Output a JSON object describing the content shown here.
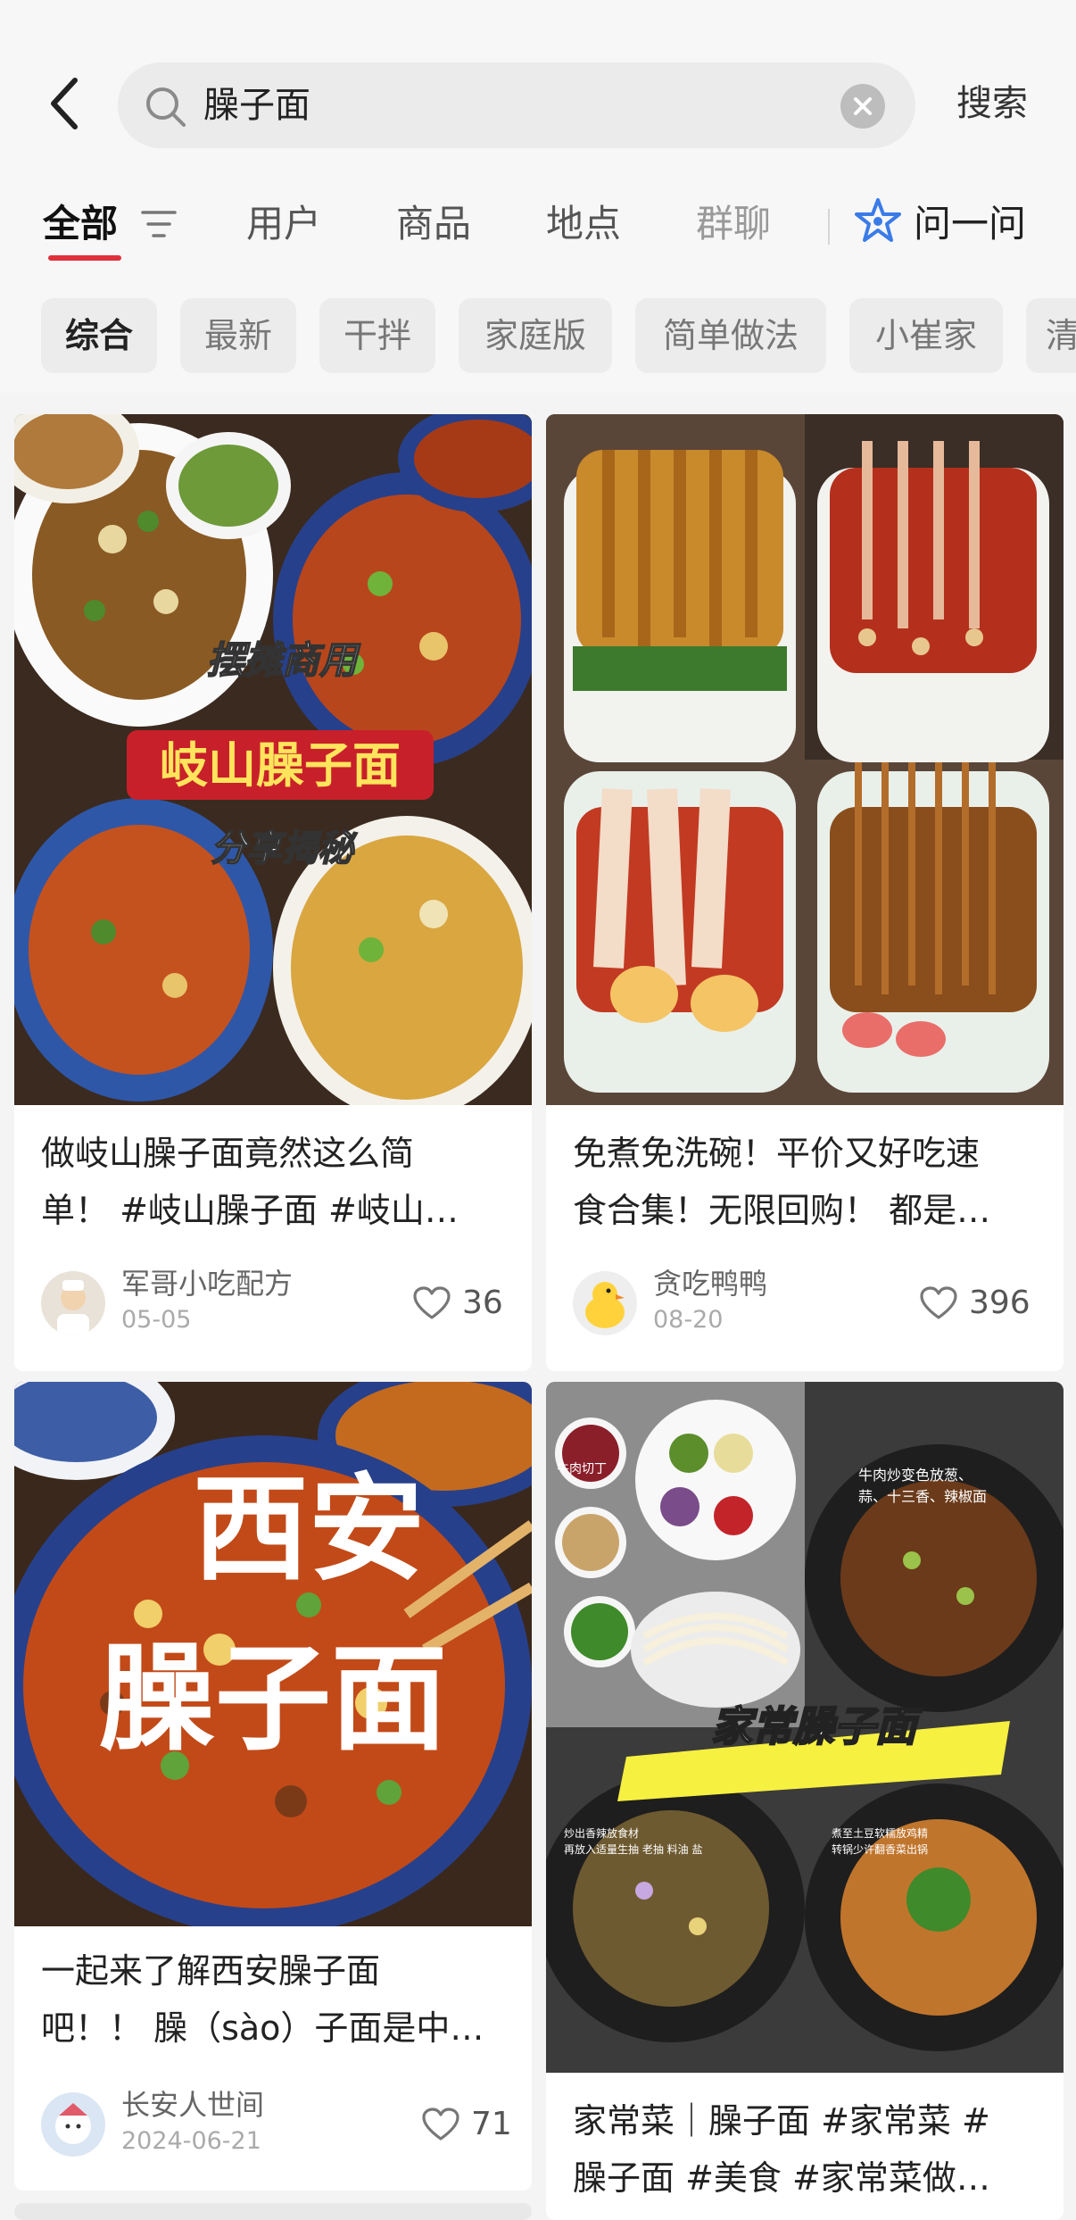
{
  "search": {
    "query": "臊子面",
    "submit_label": "搜索"
  },
  "tabs": [
    {
      "label": "全部"
    },
    {
      "label": "用户"
    },
    {
      "label": "商品"
    },
    {
      "label": "地点"
    },
    {
      "label": "群聊"
    },
    {
      "label": "问一问"
    }
  ],
  "chips": [
    {
      "label": "综合"
    },
    {
      "label": "最新"
    },
    {
      "label": "干拌"
    },
    {
      "label": "家庭版"
    },
    {
      "label": "简单做法"
    },
    {
      "label": "小崔家"
    },
    {
      "label": "清"
    }
  ],
  "colors": {
    "accent": "#e0303c",
    "ask_icon": "#3a7be8"
  },
  "cards": [
    {
      "image_overlay": [
        "摆摊商用",
        "岐山臊子面",
        "分享揭秘"
      ],
      "title_lines": [
        "做岐山臊子面竟然这么简",
        "单！ #岐山臊子面 #岐山…"
      ],
      "author": "军哥小吃配方",
      "date": "05-05",
      "likes": "36"
    },
    {
      "image_overlay": [],
      "title_lines": [
        "免煮免洗碗！平价又好吃速",
        "食合集！无限回购！ 都是…"
      ],
      "author": "贪吃鸭鸭",
      "date": "08-20",
      "likes": "396"
    },
    {
      "image_overlay": [
        "西安",
        "臊子面"
      ],
      "title_lines": [
        "一起来了解西安臊子面",
        "吧！！ 臊（sào）子面是中…"
      ],
      "author": "长安人世间",
      "date": "2024-06-21",
      "likes": "71"
    },
    {
      "image_overlay": [
        "家常臊子面",
        "牛肉切丁",
        "牛肉炒变色放葱、",
        "蒜、十三香、辣椒面",
        "炒出香辣放食材",
        "再放入适量生抽 老抽 料油 盐",
        "煮至土豆软糯放鸡精",
        "转锅少许翻香菜出锅"
      ],
      "title_lines": [
        "家常菜｜臊子面 #家常菜 #",
        "臊子面 #美食 #家常菜做…"
      ],
      "author": "",
      "date": "",
      "likes": ""
    }
  ]
}
